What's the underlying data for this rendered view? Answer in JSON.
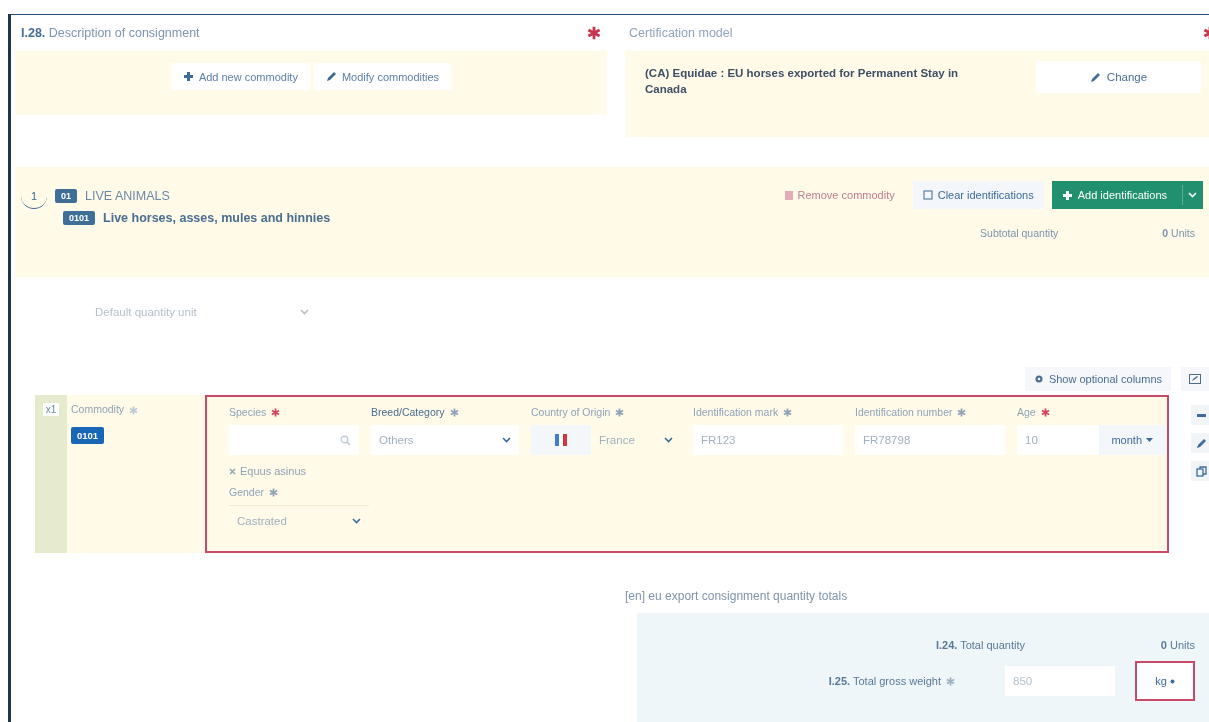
{
  "consignment": {
    "section_number": "I.28.",
    "title": "Description of consignment",
    "buttons": [
      {
        "kind": "add",
        "label": "Add new commodity"
      },
      {
        "kind": "edit",
        "label": "Modify commodities"
      }
    ]
  },
  "certification_model": {
    "title": "Certification model",
    "model": "(CA) Equidae : EU horses exported for Permanent Stay in Canada",
    "change_button": "Change"
  },
  "commodity": {
    "index": "1",
    "chapter_code": "01",
    "chapter_name": "LIVE ANIMALS",
    "heading_code": "0101",
    "heading_name": "Live horses, asses, mules and hinnies",
    "actions": [
      {
        "kind": "remove",
        "label": "Remove commodity",
        "disabled": true
      },
      {
        "kind": "clear",
        "label": "Clear identifications",
        "disabled": false
      },
      {
        "kind": "add",
        "label": "Add identifications",
        "disabled": false
      }
    ],
    "subtotal_label": "Subtotal quantity",
    "subtotal_value": "0",
    "subtotal_unit": "Units"
  },
  "default_quantity_unit": {
    "placeholder": "Default quantity unit"
  },
  "show_optional_columns": "Show optional columns",
  "identification": {
    "count": "x1",
    "commodity_label": "Commodity",
    "commodity_code": "0101",
    "highlighted": true,
    "fields": [
      {
        "kind": "search",
        "label": "Species",
        "color": "#d0465e",
        "tag": "Equus asinus"
      },
      {
        "kind": "select",
        "label": "Breed/Category",
        "color": "#8fa3b8",
        "value": "Others"
      },
      {
        "kind": "country",
        "label": "Country of Origin",
        "color": "#8fa3b8",
        "value": "France"
      },
      {
        "kind": "text",
        "label": "Identification mark",
        "color": "#8fa3b8",
        "value": "FR123"
      },
      {
        "kind": "text",
        "label": "Identification number",
        "color": "#8fa3b8",
        "value": "FR78798"
      },
      {
        "kind": "unit",
        "label": "Age",
        "color": "#d0465e",
        "value": "10",
        "unit": "month"
      }
    ],
    "gender": {
      "label": "Gender",
      "color": "#8fa3b8",
      "value": "Castrated"
    }
  },
  "totals": {
    "title": "[en] eu export consignment quantity totals",
    "quantity_number": "I.24.",
    "quantity_label": "Total quantity",
    "quantity_value": "0",
    "quantity_unit": "Units",
    "weight_number": "I.25.",
    "weight_label": "Total gross weight",
    "weight_value": "850",
    "weight_unit": "kg",
    "unit_highlighted": true
  }
}
